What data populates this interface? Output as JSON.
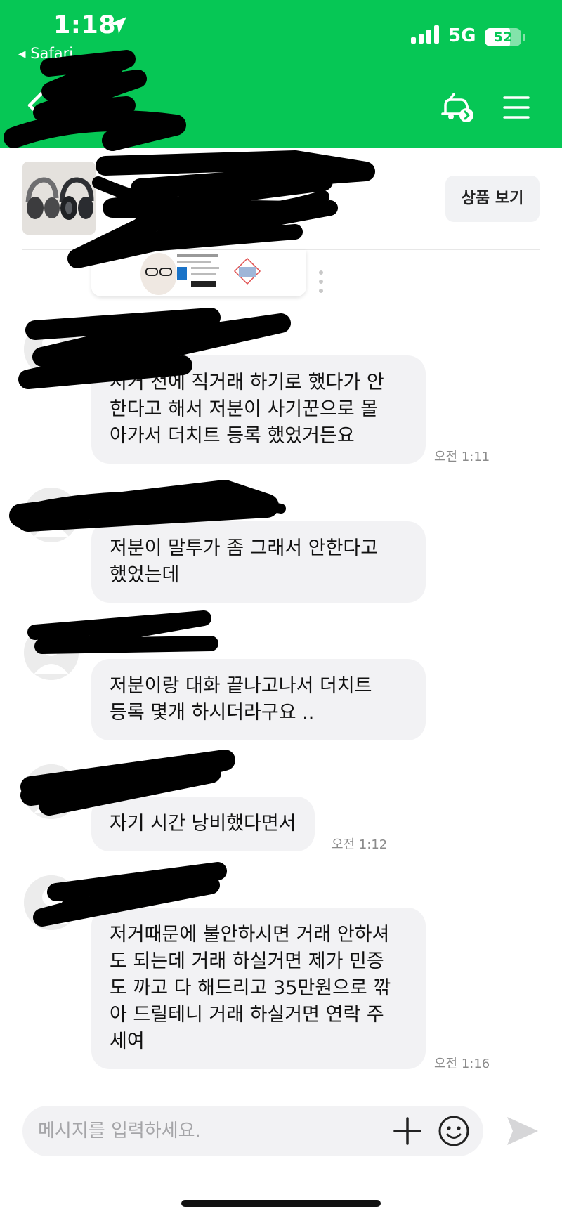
{
  "status_bar": {
    "time": "1:18",
    "back_app": "◂ Safari",
    "network": "5G",
    "battery": "52"
  },
  "header": {
    "title": "",
    "subtitle": "",
    "background_color": "#06c755"
  },
  "product": {
    "name": "",
    "price": "",
    "view_button": "상품 보기"
  },
  "messages": [
    {
      "sender": "",
      "text": "저거 전에 직거래 하기로 했다가 안\n한다고 해서 저분이 사기꾼으로 몰\n아가서 더치트 등록 했었거든요",
      "time": "오전 1:11"
    },
    {
      "sender": "",
      "text": "저분이 말투가 좀 그래서 안한다고\n했었는데",
      "time": ""
    },
    {
      "sender": "",
      "text": "저분이랑 대화 끝나고나서 더치트\n등록 몇개 하시더라구요 ..",
      "time": ""
    },
    {
      "sender": "",
      "text": "자기 시간 낭비했다면서",
      "time": "오전 1:12"
    },
    {
      "sender": "",
      "text": "저거때문에 불안하시면 거래 안하셔\n도 되는데 거래 하실거면 제가 민증\n도 까고 다 해드리고 35만원으로 깎\n아 드릴테니 거래 하실거면 연락 주\n세여",
      "time": "오전 1:16"
    }
  ],
  "input": {
    "placeholder": "메시지를 입력하세요."
  },
  "icons": {
    "location": "location-arrow-icon",
    "signal": "signal-bars-icon",
    "battery": "battery-icon",
    "back": "chevron-left-icon",
    "car": "car-icon",
    "menu": "hamburger-menu-icon",
    "avatar": "default-avatar-icon",
    "plus": "plus-icon",
    "emoji": "smiley-icon",
    "send": "send-icon",
    "more": "vertical-dots-icon"
  }
}
